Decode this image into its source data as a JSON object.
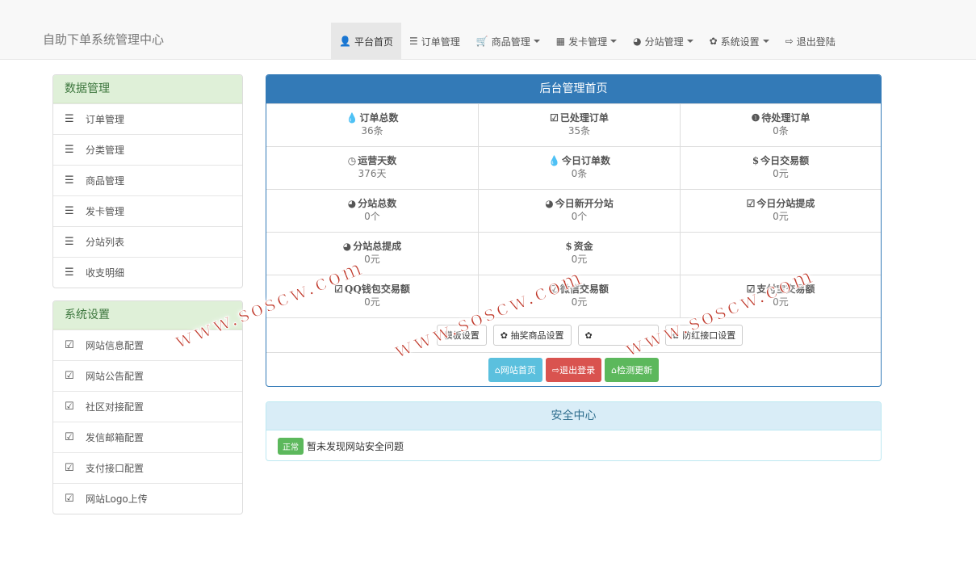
{
  "brand": "自助下单系统管理中心",
  "nav": [
    {
      "label": "平台首页",
      "icon": "user-icon",
      "glyph": "👤",
      "caret": false,
      "active": true
    },
    {
      "label": "订单管理",
      "icon": "list-icon",
      "glyph": "☰",
      "caret": false,
      "active": false
    },
    {
      "label": "商品管理",
      "icon": "cart-icon",
      "glyph": "🛒",
      "caret": true,
      "active": false
    },
    {
      "label": "发卡管理",
      "icon": "grid-icon",
      "glyph": "▦",
      "caret": true,
      "active": false
    },
    {
      "label": "分站管理",
      "icon": "globe-icon",
      "glyph": "◕",
      "caret": true,
      "active": false
    },
    {
      "label": "系统设置",
      "icon": "gear-icon",
      "glyph": "✿",
      "caret": true,
      "active": false
    },
    {
      "label": "退出登陆",
      "icon": "logout-icon",
      "glyph": "⇨",
      "caret": false,
      "active": false
    }
  ],
  "sidebar": {
    "data_title": "数据管理",
    "data_items": [
      "订单管理",
      "分类管理",
      "商品管理",
      "发卡管理",
      "分站列表",
      "收支明细"
    ],
    "settings_title": "系统设置",
    "settings_items": [
      "网站信息配置",
      "网站公告配置",
      "社区对接配置",
      "发信邮箱配置",
      "支付接口配置",
      "网站Logo上传"
    ]
  },
  "main": {
    "title": "后台管理首页",
    "stats": [
      {
        "label": "订单总数",
        "value": "36条",
        "icon": "drop-icon",
        "glyph": "💧"
      },
      {
        "label": "已处理订单",
        "value": "35条",
        "icon": "check-icon",
        "glyph": "☑"
      },
      {
        "label": "待处理订单",
        "value": "0条",
        "icon": "alert-icon",
        "glyph": "❶"
      },
      {
        "label": "运营天数",
        "value": "376天",
        "icon": "clock-icon",
        "glyph": "◷"
      },
      {
        "label": "今日订单数",
        "value": "0条",
        "icon": "drop-icon",
        "glyph": "💧"
      },
      {
        "label": "今日交易额",
        "value": "0元",
        "icon": "dollar-icon",
        "glyph": "$"
      },
      {
        "label": "分站总数",
        "value": "0个",
        "icon": "globe-icon",
        "glyph": "◕"
      },
      {
        "label": "今日新开分站",
        "value": "0个",
        "icon": "globe-icon",
        "glyph": "◕"
      },
      {
        "label": "今日分站提成",
        "value": "0元",
        "icon": "check-icon",
        "glyph": "☑"
      },
      {
        "label": "分站总提成",
        "value": "0元",
        "icon": "globe-icon",
        "glyph": "◕"
      },
      {
        "label": "资金",
        "value": "0元",
        "icon": "dollar-icon",
        "glyph": "$"
      },
      {
        "label": "",
        "value": "",
        "icon": "blank-icon",
        "glyph": ""
      },
      {
        "label": "QQ钱包交易额",
        "value": "0元",
        "icon": "check-icon",
        "glyph": "☑"
      },
      {
        "label": "微信交易额",
        "value": "0元",
        "icon": "check-icon",
        "glyph": "☑"
      },
      {
        "label": "支付宝交易额",
        "value": "0元",
        "icon": "check-icon",
        "glyph": "☑"
      }
    ],
    "settings_buttons": [
      "模板设置",
      "抽奖商品设置",
      "",
      "防红接口设置"
    ],
    "action_buttons": [
      {
        "label": "网站首页",
        "icon": "home-icon",
        "glyph": "⌂"
      },
      {
        "label": "退出登录",
        "icon": "logout-icon",
        "glyph": "⇨"
      },
      {
        "label": "检测更新",
        "icon": "home-icon",
        "glyph": "⌂"
      }
    ]
  },
  "security": {
    "title": "安全中心",
    "badge": "正常",
    "message": "暂未发现网站安全问题"
  },
  "watermark": "www.soscw.com",
  "colors": {
    "primary": "#337ab7",
    "success": "#5cb85c",
    "danger": "#d9534f",
    "info": "#5bc0de",
    "sidebar_head": "#dff0d8"
  }
}
